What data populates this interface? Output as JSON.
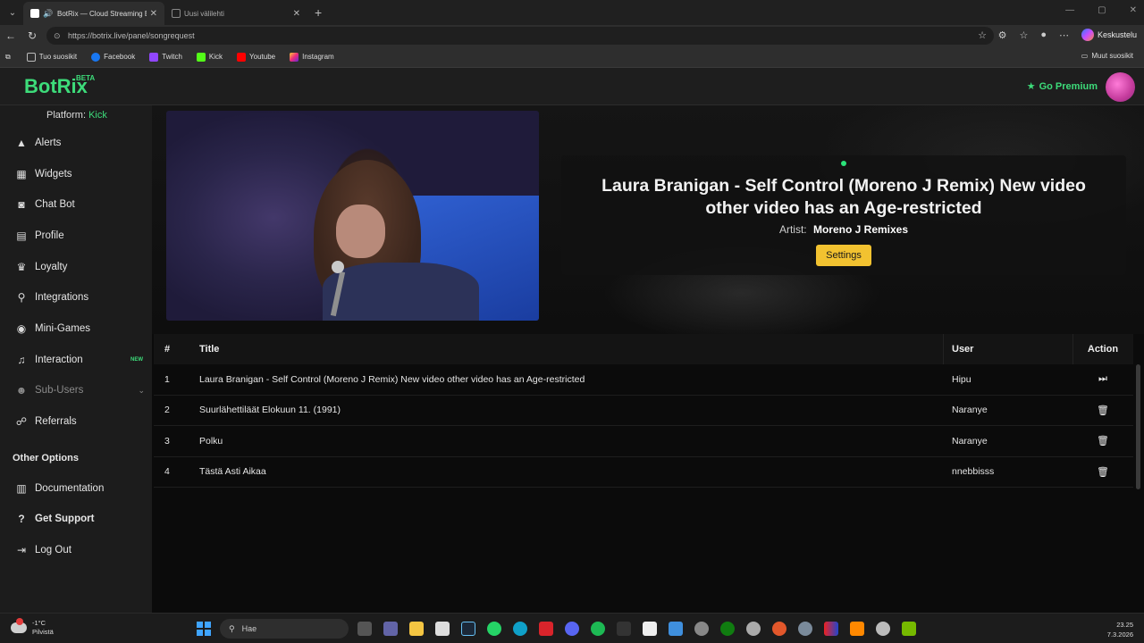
{
  "browser": {
    "tabs": [
      {
        "title": "BotRix — Cloud Streaming Bot",
        "active": true
      },
      {
        "title": "Uusi välilehti",
        "active": false
      }
    ],
    "url_host": "https://botrix.live",
    "url_path": "/panel/songrequest",
    "copilot_label": "Keskustelu",
    "bookmarks": [
      {
        "label": "Tuo suosikit"
      },
      {
        "label": "Facebook"
      },
      {
        "label": "Twitch"
      },
      {
        "label": "Kick"
      },
      {
        "label": "Youtube"
      },
      {
        "label": "Instagram"
      }
    ],
    "other_bookmarks": "Muut suosikit"
  },
  "header": {
    "logo": "BotRix",
    "beta": "BETA",
    "premium": "Go Premium"
  },
  "sidebar": {
    "platform_label": "Platform:",
    "platform_value": "Kick",
    "items": [
      {
        "label": "Alerts",
        "icon": "warning-icon"
      },
      {
        "label": "Widgets",
        "icon": "grid-icon"
      },
      {
        "label": "Chat Bot",
        "icon": "robot-icon"
      },
      {
        "label": "Profile",
        "icon": "id-card-icon"
      },
      {
        "label": "Loyalty",
        "icon": "trophy-icon"
      },
      {
        "label": "Integrations",
        "icon": "plug-icon"
      },
      {
        "label": "Mini-Games",
        "icon": "gamepad-icon"
      },
      {
        "label": "Interaction",
        "icon": "music-icon",
        "badge": "NEW"
      },
      {
        "label": "Sub-Users",
        "icon": "users-icon"
      },
      {
        "label": "Referrals",
        "icon": "referrals-icon"
      }
    ],
    "other_title": "Other Options",
    "other_items": [
      {
        "label": "Documentation",
        "icon": "book-icon"
      },
      {
        "label": "Get Support",
        "icon": "question-icon"
      },
      {
        "label": "Log Out",
        "icon": "logout-icon"
      }
    ]
  },
  "now_playing": {
    "title": "Laura Branigan - Self Control (Moreno J Remix) New video other video has an Age-restricted",
    "artist_label": "Artist:",
    "artist": "Moreno J Remixes",
    "settings_label": "Settings"
  },
  "queue": {
    "headers": {
      "num": "#",
      "title": "Title",
      "user": "User",
      "action": "Action"
    },
    "rows": [
      {
        "num": "1",
        "title": "Laura Branigan - Self Control (Moreno J Remix) New video other video has an Age-restricted",
        "user": "Hipu",
        "action": "skip-icon"
      },
      {
        "num": "2",
        "title": "Suurlähettiläät Elokuun 11. (1991)",
        "user": "Naranye",
        "action": "trash-icon"
      },
      {
        "num": "3",
        "title": "Polku",
        "user": "Naranye",
        "action": "trash-icon"
      },
      {
        "num": "4",
        "title": "Tästä Asti Aikaa",
        "user": "nnebbisss",
        "action": "trash-icon"
      }
    ]
  },
  "taskbar": {
    "temperature": "-1°C",
    "weather": "Pilvistä",
    "search_placeholder": "Hae",
    "time": "23.25",
    "date": "7.3.2026"
  }
}
